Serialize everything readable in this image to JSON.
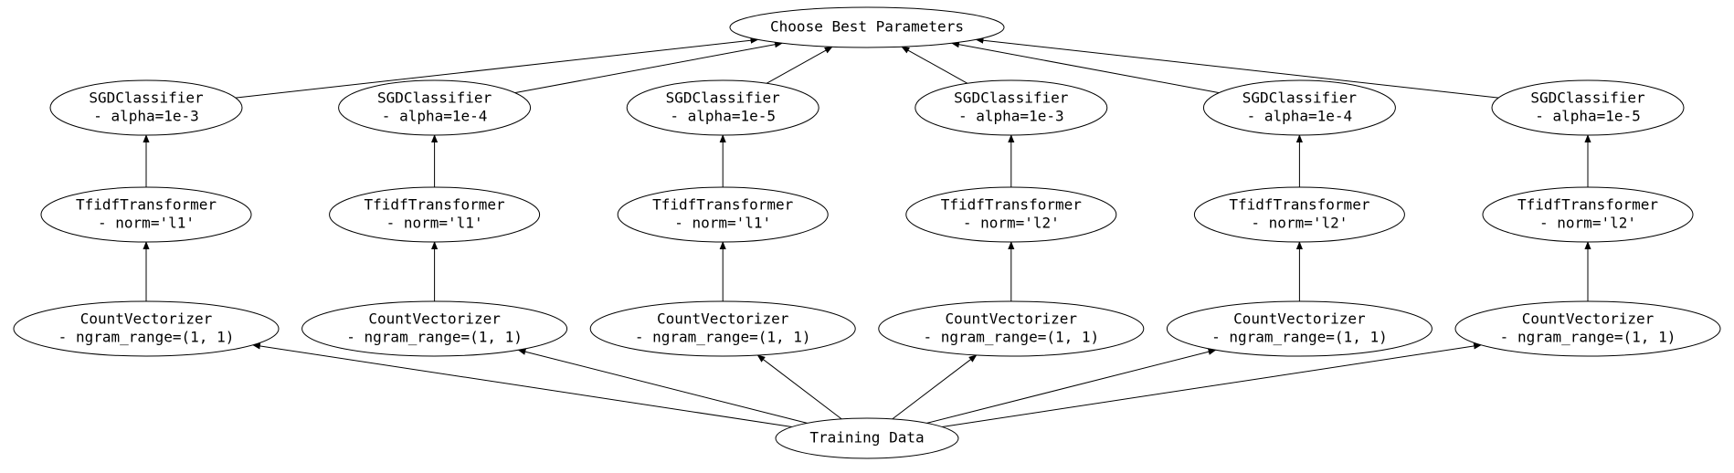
{
  "root": {
    "label": "Choose Best Parameters"
  },
  "bottom": {
    "label": "Training Data"
  },
  "columns": [
    {
      "sgd": {
        "line1": "SGDClassifier",
        "line2": "- alpha=1e-3"
      },
      "tfidf": {
        "line1": "TfidfTransformer",
        "line2": "- norm='l1'"
      },
      "count": {
        "line1": "CountVectorizer",
        "line2": "- ngram_range=(1, 1)"
      }
    },
    {
      "sgd": {
        "line1": "SGDClassifier",
        "line2": "- alpha=1e-4"
      },
      "tfidf": {
        "line1": "TfidfTransformer",
        "line2": "- norm='l1'"
      },
      "count": {
        "line1": "CountVectorizer",
        "line2": "- ngram_range=(1, 1)"
      }
    },
    {
      "sgd": {
        "line1": "SGDClassifier",
        "line2": "- alpha=1e-5"
      },
      "tfidf": {
        "line1": "TfidfTransformer",
        "line2": "- norm='l1'"
      },
      "count": {
        "line1": "CountVectorizer",
        "line2": "- ngram_range=(1, 1)"
      }
    },
    {
      "sgd": {
        "line1": "SGDClassifier",
        "line2": "- alpha=1e-3"
      },
      "tfidf": {
        "line1": "TfidfTransformer",
        "line2": "- norm='l2'"
      },
      "count": {
        "line1": "CountVectorizer",
        "line2": "- ngram_range=(1, 1)"
      }
    },
    {
      "sgd": {
        "line1": "SGDClassifier",
        "line2": "- alpha=1e-4"
      },
      "tfidf": {
        "line1": "TfidfTransformer",
        "line2": "- norm='l2'"
      },
      "count": {
        "line1": "CountVectorizer",
        "line2": "- ngram_range=(1, 1)"
      }
    },
    {
      "sgd": {
        "line1": "SGDClassifier",
        "line2": "- alpha=1e-5"
      },
      "tfidf": {
        "line1": "TfidfTransformer",
        "line2": "- norm='l2'"
      },
      "count": {
        "line1": "CountVectorizer",
        "line2": "- ngram_range=(1, 1)"
      }
    }
  ]
}
